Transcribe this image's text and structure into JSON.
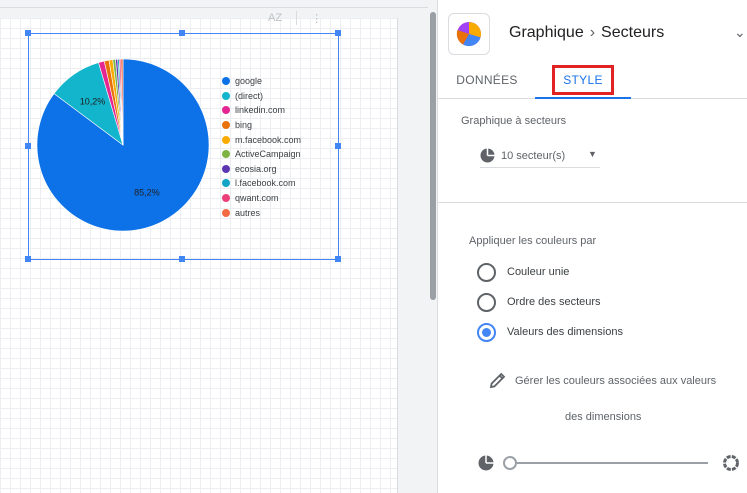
{
  "header": {
    "chart_label": "Graphique",
    "separator": "›",
    "chart_type": "Secteurs"
  },
  "tabs": [
    {
      "label": "DONNÉES",
      "active": false
    },
    {
      "label": "STYLE",
      "active": true
    }
  ],
  "style_panel": {
    "pie_section_title": "Graphique à secteurs",
    "slices_value": "10 secteur(s)",
    "colors_section_title": "Appliquer les couleurs par",
    "color_options": [
      {
        "label": "Couleur unie",
        "checked": false
      },
      {
        "label": "Ordre des secteurs",
        "checked": false
      },
      {
        "label": "Valeurs des dimensions",
        "checked": true
      }
    ],
    "manage_colors_line1": "Gérer les couleurs associées aux valeurs",
    "manage_colors_line2": "des dimensions",
    "hole_size": 0
  },
  "toolbar": {
    "sort_icon": "AZ",
    "more_icon": "⋮"
  },
  "chart_data": {
    "type": "pie",
    "slices": [
      {
        "label": "google",
        "value": 85.2,
        "color": "#0d72e8"
      },
      {
        "label": "(direct)",
        "value": 10.2,
        "color": "#12b5cb"
      },
      {
        "label": "linkedin.com",
        "value": 1.1,
        "color": "#e52592"
      },
      {
        "label": "bing",
        "value": 0.9,
        "color": "#e8710a"
      },
      {
        "label": "m.facebook.com",
        "value": 0.7,
        "color": "#f9ab00"
      },
      {
        "label": "ActiveCampaign",
        "value": 0.5,
        "color": "#7cb342"
      },
      {
        "label": "ecosia.org",
        "value": 0.4,
        "color": "#5e35b1"
      },
      {
        "label": "l.facebook.com",
        "value": 0.3,
        "color": "#12a4c4"
      },
      {
        "label": "qwant.com",
        "value": 0.3,
        "color": "#ec407a"
      },
      {
        "label": "autres",
        "value": 0.4,
        "color": "#f26b45"
      }
    ],
    "labels": [
      {
        "text": "85,2%",
        "slice": 0
      },
      {
        "text": "10,2%",
        "slice": 1
      }
    ],
    "legend_position": "right"
  }
}
